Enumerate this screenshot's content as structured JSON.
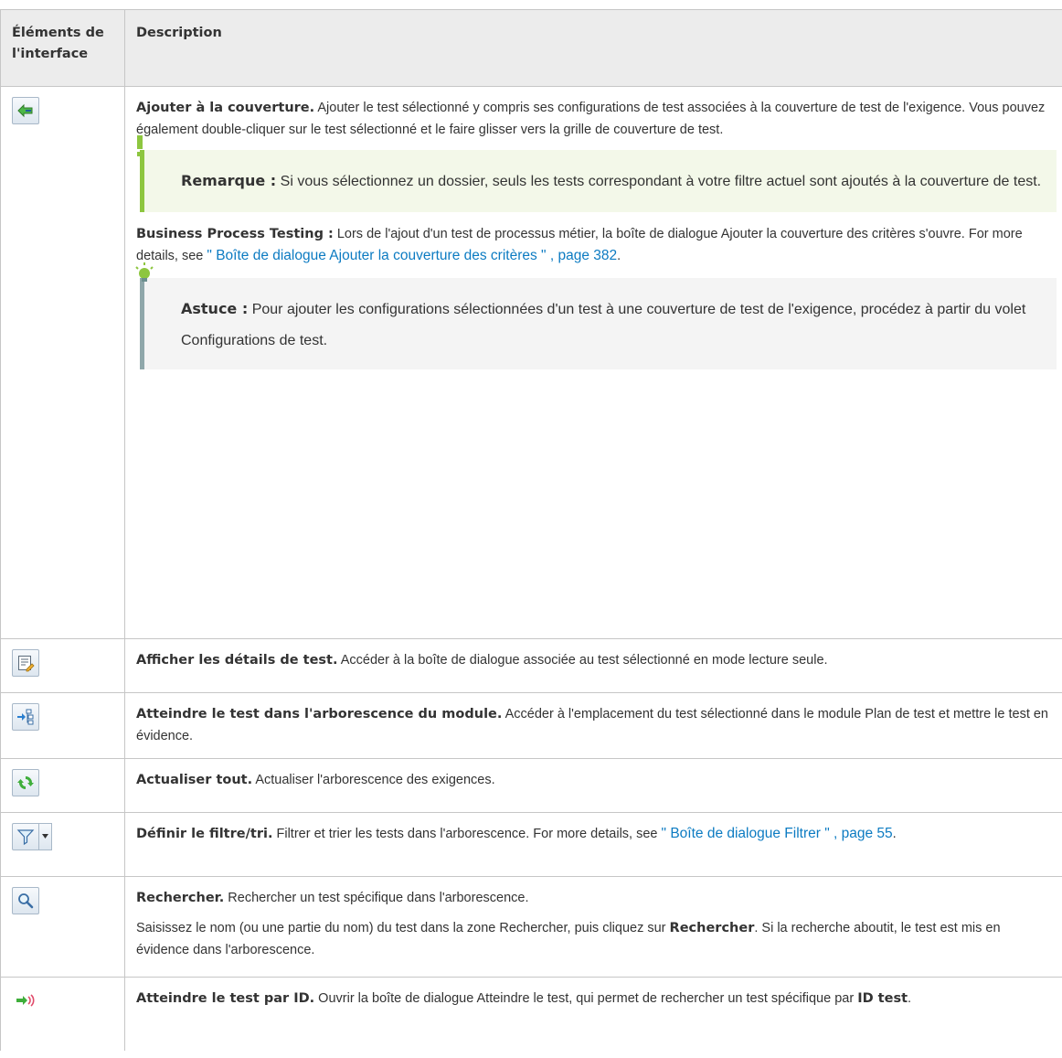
{
  "headers": {
    "col1": "Éléments de l'interface",
    "col2": "Description"
  },
  "rows": [
    {
      "icon": "add-to-coverage-arrow-icon",
      "title": "Ajouter à la couverture.",
      "text": " Ajouter le test sélectionné y compris ses configurations de test associées à la couverture de test de l'exigence. Vous pouvez également double-cliquer sur le test sélectionné et le faire glisser vers la grille de couverture de test.",
      "note_label": "Remarque :",
      "note_text": " Si vous sélectionnez un dossier, seuls les tests correspondant à votre filtre actuel sont ajoutés à la couverture de test.",
      "bpt_label": "Business Process Testing :",
      "bpt_text": " Lors de l'ajout d'un test de processus métier, la boîte de dialogue Ajouter la couverture des critères s'ouvre. For more details, see ",
      "bpt_link": "\" Boîte de dialogue Ajouter la couverture des critères \" , page 382",
      "bpt_end": ".",
      "tip_label": "Astuce :",
      "tip_text": " Pour ajouter les configurations sélectionnées d'un test à une couverture de test de l'exigence, procédez à partir du volet Configurations de test."
    },
    {
      "icon": "test-details-icon",
      "title": "Afficher les détails de test.",
      "text": " Accéder à la boîte de dialogue associée au test sélectionné en mode lecture seule."
    },
    {
      "icon": "go-to-module-tree-icon",
      "title": "Atteindre le test dans l'arborescence du module.",
      "text": " Accéder à l'emplacement du test sélectionné dans le module Plan de test et mettre le test en évidence."
    },
    {
      "icon": "refresh-icon",
      "title": "Actualiser tout.",
      "text": " Actualiser l'arborescence des exigences."
    },
    {
      "icon": "filter-icon",
      "title": "Définir le filtre/tri.",
      "text": " Filtrer et trier les tests dans l'arborescence. For more details, see ",
      "link": "\" Boîte de dialogue Filtrer \" , page 55",
      "end": "."
    },
    {
      "icon": "find-magnifier-icon",
      "title": "Rechercher.",
      "text": " Rechercher un test spécifique dans l'arborescence.",
      "p2_a": "Saisissez le nom (ou une partie du nom) du test dans la zone Rechercher, puis cliquez sur ",
      "p2_bold": "Rechercher",
      "p2_b": ". Si la recherche aboutit, le test est mis en évidence dans l'arborescence."
    },
    {
      "icon": "go-to-test-by-id-icon",
      "title": "Atteindre le test par ID.",
      "text": " Ouvrir la boîte de dialogue Atteindre le test, qui permet de rechercher un test spécifique par ",
      "bold": "ID test",
      "end": "."
    }
  ]
}
